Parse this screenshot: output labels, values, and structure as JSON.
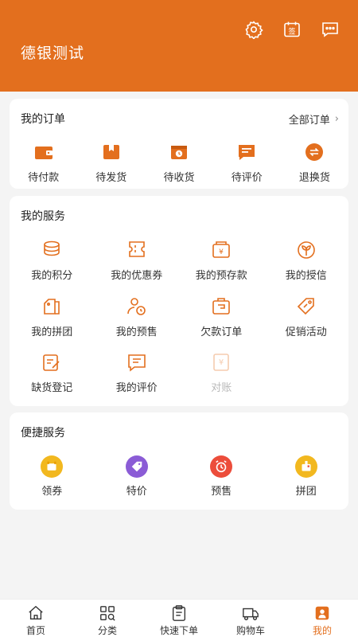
{
  "header": {
    "store_name": "德银测试",
    "icons": [
      "gear-icon",
      "sign-in-icon",
      "message-icon"
    ],
    "accent_color": "#e36f1e",
    "sign_label": "签"
  },
  "orders": {
    "title": "我的订单",
    "all_link": "全部订单",
    "items": [
      {
        "label": "待付款",
        "icon": "wallet-icon"
      },
      {
        "label": "待发货",
        "icon": "package-icon"
      },
      {
        "label": "待收货",
        "icon": "box-clock-icon"
      },
      {
        "label": "待评价",
        "icon": "comment-icon"
      },
      {
        "label": "退换货",
        "icon": "exchange-icon"
      }
    ]
  },
  "services": {
    "title": "我的服务",
    "items": [
      {
        "label": "我的积分",
        "icon": "coins-icon"
      },
      {
        "label": "我的优惠券",
        "icon": "coupon-icon"
      },
      {
        "label": "我的预存款",
        "icon": "deposit-icon"
      },
      {
        "label": "我的授信",
        "icon": "credit-icon"
      },
      {
        "label": "我的拼团",
        "icon": "group-icon"
      },
      {
        "label": "我的预售",
        "icon": "presale-icon"
      },
      {
        "label": "欠款订单",
        "icon": "debt-order-icon"
      },
      {
        "label": "促销活动",
        "icon": "promotion-tag-icon"
      },
      {
        "label": "缺货登记",
        "icon": "register-icon"
      },
      {
        "label": "我的评价",
        "icon": "review-icon"
      },
      {
        "label": "对账",
        "icon": "reconcile-icon"
      }
    ]
  },
  "quick": {
    "title": "便捷服务",
    "items": [
      {
        "label": "领券",
        "icon": "get-coupon-icon",
        "color": "#f2b81f"
      },
      {
        "label": "特价",
        "icon": "special-price-icon",
        "color": "#8b5cd6"
      },
      {
        "label": "预售",
        "icon": "presale-clock-icon",
        "color": "#ec4d3b"
      },
      {
        "label": "拼团",
        "icon": "group-buy-icon",
        "color": "#f2b81f"
      }
    ]
  },
  "tabbar": {
    "items": [
      {
        "label": "首页",
        "icon": "home-icon"
      },
      {
        "label": "分类",
        "icon": "category-icon"
      },
      {
        "label": "快速下单",
        "icon": "quick-order-icon"
      },
      {
        "label": "购物车",
        "icon": "cart-truck-icon"
      },
      {
        "label": "我的",
        "icon": "mine-icon"
      }
    ],
    "active": "我的"
  }
}
